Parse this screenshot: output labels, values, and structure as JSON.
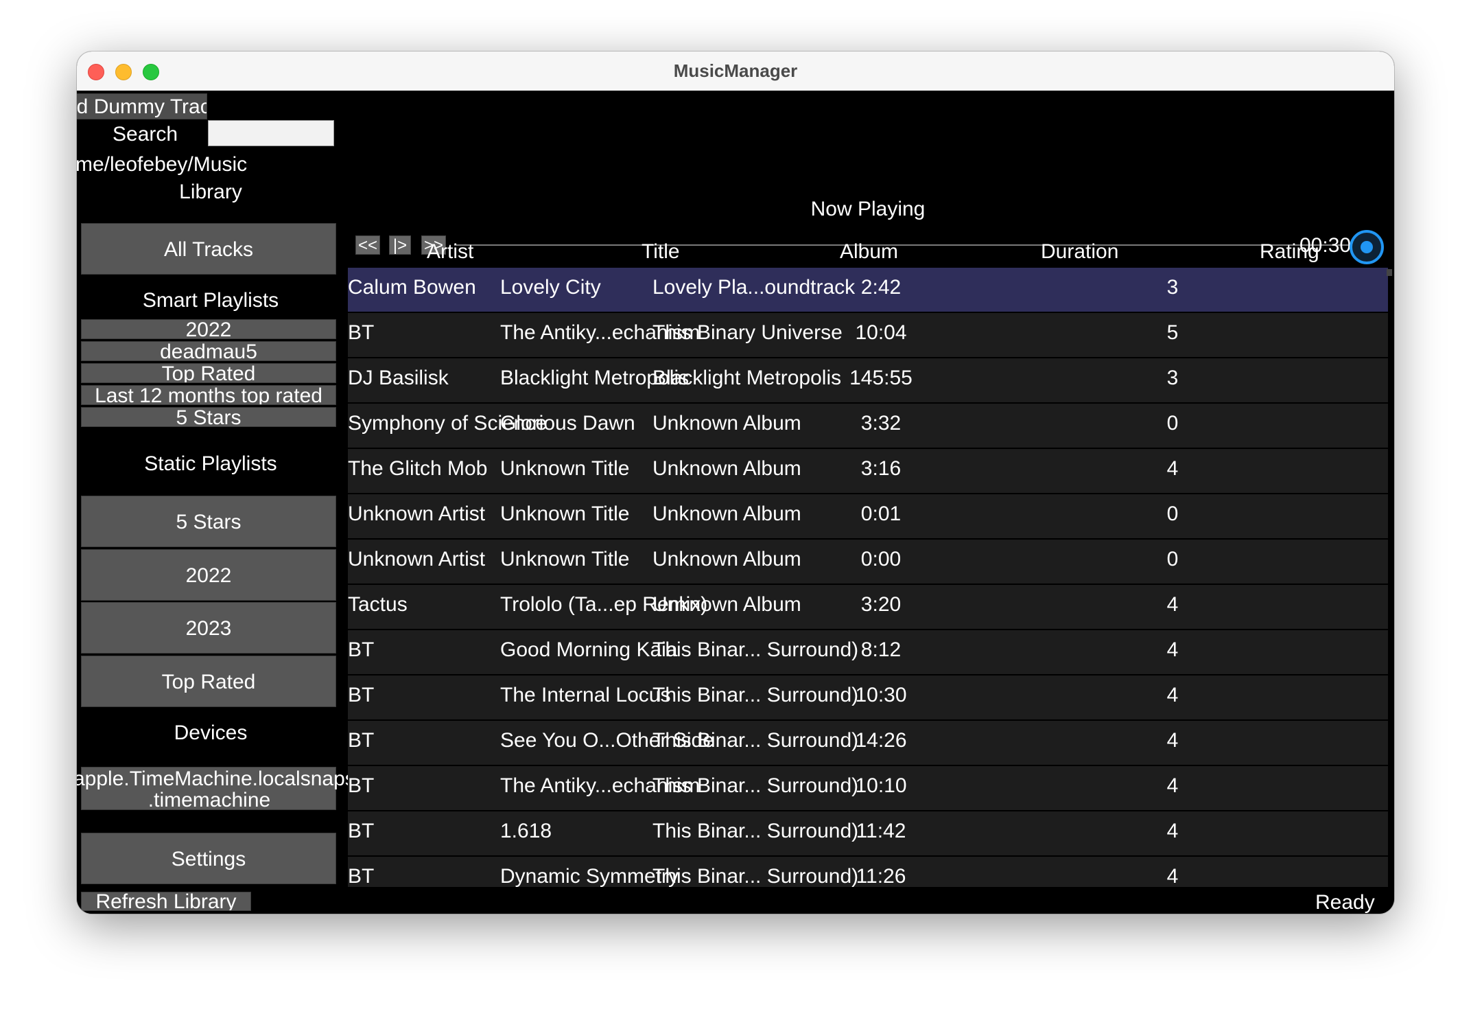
{
  "window": {
    "title": "MusicManager"
  },
  "sidebar": {
    "load_dummy_label": "ad Dummy Tracks",
    "search_label": "Search",
    "search_value": "",
    "path_text": "me/leofebey/Music",
    "library_heading": "Library",
    "all_tracks_label": "All Tracks",
    "smart_heading": "Smart Playlists",
    "smart_items": [
      "2022",
      "deadmau5",
      "Top Rated",
      "Last 12 months top rated",
      "5 Stars"
    ],
    "static_heading": "Static Playlists",
    "static_items": [
      "5 Stars",
      "2022",
      "2023",
      "Top Rated"
    ],
    "devices_heading": "Devices",
    "device_line1": "apple.TimeMachine.localsnaps",
    "device_line2": ".timemachine",
    "settings_label": "Settings",
    "refresh_label": "Refresh Library"
  },
  "player": {
    "now_playing": "Now Playing",
    "prev_label": "<<",
    "play_label": "|>",
    "next_label": ">>",
    "time": "00:30",
    "progress": 1.0
  },
  "table": {
    "columns": [
      "Artist",
      "Title",
      "Album",
      "Duration",
      "Rating"
    ],
    "rows": [
      [
        "Calum Bowen",
        "Lovely City",
        "Lovely Pla...oundtrack",
        "2:42",
        "3"
      ],
      [
        "BT",
        "The Antiky...echanism",
        "This Binary Universe",
        "10:04",
        "5"
      ],
      [
        "DJ Basilisk",
        "Blacklight Metropolis",
        "Blacklight Metropolis",
        "145:55",
        "3"
      ],
      [
        "Symphony of Science",
        "Glorious Dawn",
        "Unknown Album",
        "3:32",
        "0"
      ],
      [
        "The Glitch Mob",
        "Unknown Title",
        "Unknown Album",
        "3:16",
        "4"
      ],
      [
        "Unknown Artist",
        "Unknown Title",
        "Unknown Album",
        "0:01",
        "0"
      ],
      [
        "Unknown Artist",
        "Unknown Title",
        "Unknown Album",
        "0:00",
        "0"
      ],
      [
        "Tactus",
        "Trololo (Ta...ep Remix)",
        "Unknown Album",
        "3:20",
        "4"
      ],
      [
        "BT",
        "Good Morning Kaia",
        "This Binar... Surround)",
        "8:12",
        "4"
      ],
      [
        "BT",
        "The Internal Locus",
        "This Binar... Surround)",
        "10:30",
        "4"
      ],
      [
        "BT",
        "See You O...Other Side",
        "This Binar... Surround)",
        "14:26",
        "4"
      ],
      [
        "BT",
        "The Antiky...echanism",
        "This Binar... Surround)",
        "10:10",
        "4"
      ],
      [
        "BT",
        "1.618",
        "This Binar... Surround)",
        "11:42",
        "4"
      ],
      [
        "BT",
        "Dynamic Symmetry",
        "This Binar... Surround)",
        "11:26",
        "4"
      ]
    ]
  },
  "status": {
    "text": "Ready"
  },
  "colors": {
    "selected_row": "#2f2e5a",
    "button": "#575757",
    "row": "#1d1d1d",
    "slider_knob": "#2196f3"
  }
}
